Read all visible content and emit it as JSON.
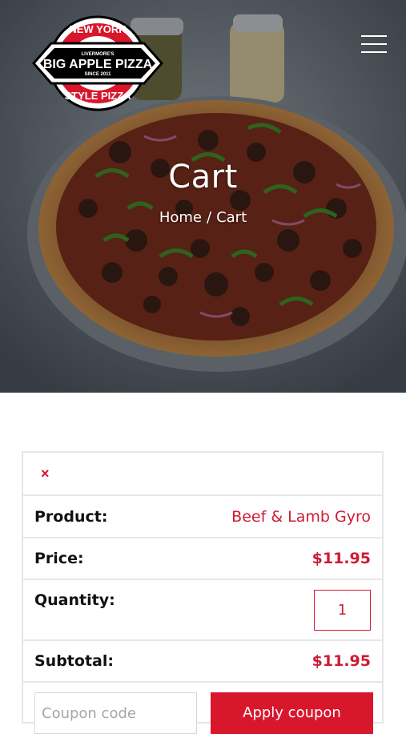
{
  "header": {
    "logo": {
      "top_text": "NEW YORK",
      "small_text": "LIVERMORE'S",
      "main_text": "BIG APPLE PIZZA",
      "since_text": "SINCE 2011",
      "bottom_text": "STYLE PIZZA"
    },
    "menu_icon": "hamburger-menu-icon"
  },
  "hero": {
    "title": "Cart",
    "breadcrumb": {
      "home": "Home",
      "separator": "/",
      "current": "Cart"
    }
  },
  "cart": {
    "remove_symbol": "×",
    "product_label": "Product:",
    "product_value": "Beef & Lamb Gyro",
    "price_label": "Price:",
    "price_value": "$11.95",
    "quantity_label": "Quantity:",
    "quantity_value": "1",
    "subtotal_label": "Subtotal:",
    "subtotal_value": "$11.95",
    "coupon_placeholder": "Coupon code",
    "apply_coupon_label": "Apply coupon"
  },
  "colors": {
    "accent": "#d8172d",
    "border": "#e7e7e7",
    "text": "#111111"
  }
}
